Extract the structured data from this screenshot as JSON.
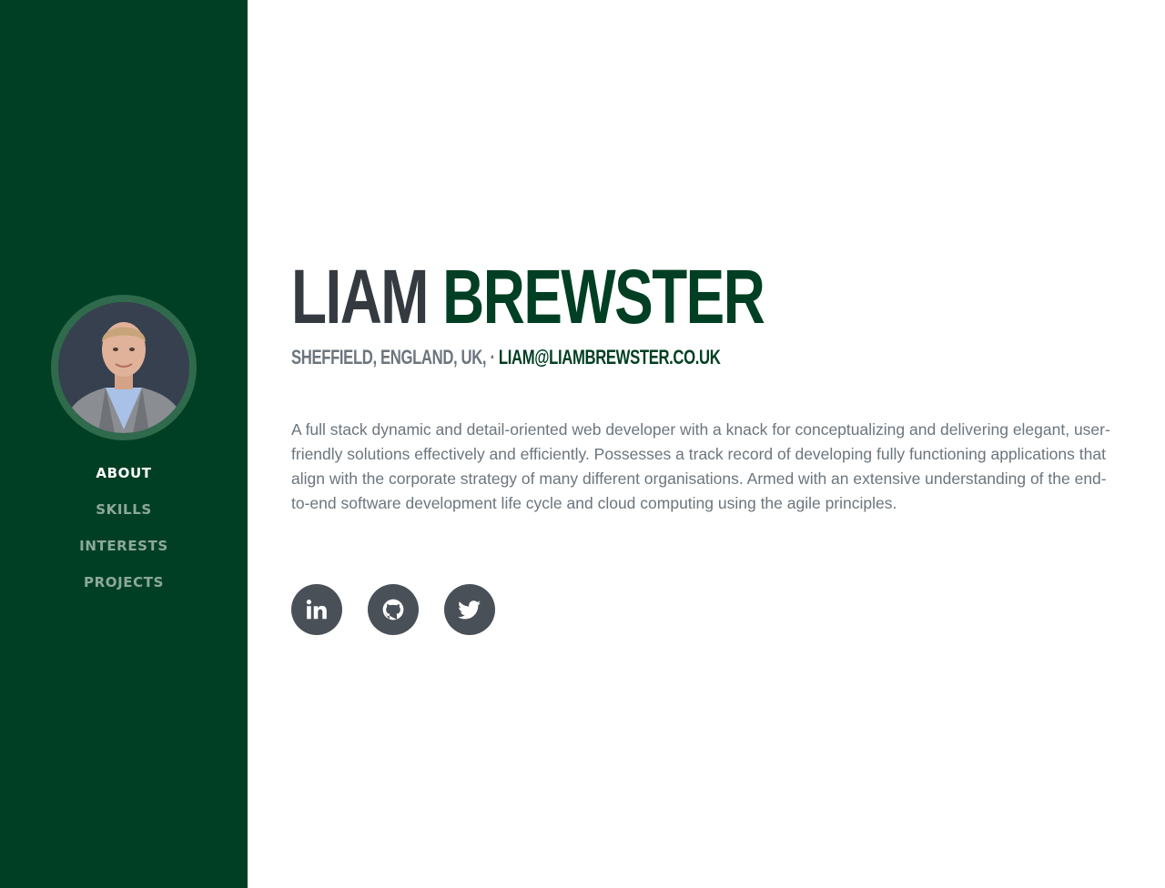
{
  "profile": {
    "first_name": "LIAM",
    "last_name": "BREWSTER",
    "location": "SHEFFIELD, ENGLAND, UK, · ",
    "email": "LIAM@LIAMBREWSTER.CO.UK",
    "bio": "A full stack dynamic and detail-oriented web developer with a knack for conceptualizing and delivering elegant, user-friendly solutions effectively and efficiently. Possesses a track record of developing fully functioning applications that align with the corporate strategy of many different organisations. Armed with an extensive understanding of the end-to-end software development life cycle and cloud computing using the agile principles."
  },
  "nav": {
    "items": [
      {
        "label": "ABOUT",
        "active": true
      },
      {
        "label": "SKILLS",
        "active": false
      },
      {
        "label": "INTERESTS",
        "active": false
      },
      {
        "label": "PROJECTS",
        "active": false
      }
    ]
  },
  "socials": [
    {
      "icon": "linkedin-icon"
    },
    {
      "icon": "github-icon"
    },
    {
      "icon": "twitter-icon"
    }
  ],
  "colors": {
    "sidebar": "#003f23",
    "avatar_border": "#2f6a4c",
    "accent": "#003f23",
    "heading": "#343a40",
    "muted": "#6c757d",
    "social_bg": "#495057"
  }
}
